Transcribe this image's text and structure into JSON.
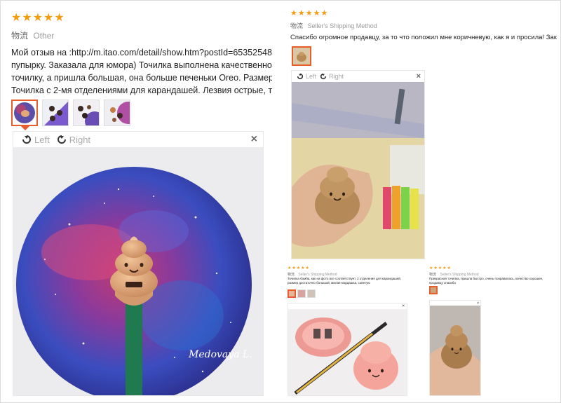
{
  "colors": {
    "star": "#f39c12",
    "accent": "#e85d2c",
    "meta_grey": "#999999"
  },
  "icons": {
    "rotate_left": "rotate-left-icon",
    "rotate_right": "rotate-right-icon",
    "close": "close-icon",
    "star": "star-icon"
  },
  "review_main": {
    "stars": "★★★★★",
    "meta_key": "物流",
    "meta_value": "Other",
    "text_lines": [
      "Мой отзыв на :http://m.itao.com/detail/show.htm?postId=65352548",
      "пупырку. Заказала для юмора) Точилка выполнена качественно,",
      "точилку, а пришла большая, она больше печеньки Oreo. Размер",
      "Точилка с 2-мя отделениями для карандашей. Лезвия острые, точ"
    ],
    "viewer": {
      "left_label": "Left",
      "right_label": "Right",
      "close": "×"
    },
    "watermark": "Medovaya L."
  },
  "review_right": {
    "stars": "★★★★★",
    "meta_key": "物流",
    "meta_value": "Seller's Shipping Method",
    "text": "Спасибо огромное продавцу, за то что положил мне коричневую, как я и просила! Заказ",
    "viewer": {
      "left_label": "Left",
      "right_label": "Right",
      "close": "×"
    }
  },
  "review_mini_1": {
    "stars": "★★★★★",
    "meta_key": "物流",
    "meta_value": "Seller's Shipping Method",
    "text": "Точилка бомба, как на фото все соответствует, 2 отделения для карандашей, размер достаточно большой, милая мордашка, советую",
    "viewer": {
      "close": "×"
    }
  },
  "review_mini_2": {
    "stars": "★★★★★",
    "meta_key": "物流",
    "meta_value": "Seller's Shipping Method",
    "text": "Прекрасная точилка, пришла быстро, очень понравилась, качество хорошее, продавцу спасибо",
    "viewer": {
      "close": "×"
    }
  }
}
